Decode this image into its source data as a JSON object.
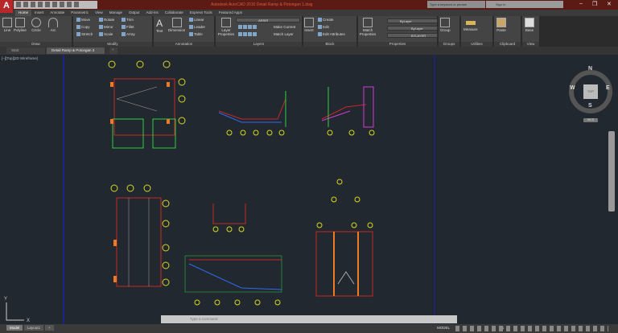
{
  "app": {
    "logo": "A",
    "title": "Autodesk AutoCAD 2016   Detail Ramp & Potongan 1.dwg",
    "search_placeholder": "Type a keyword or phrase",
    "sign_in": "Sign In"
  },
  "ribbon_tabs": [
    "Home",
    "Insert",
    "Annotate",
    "Parametric",
    "View",
    "Manage",
    "Output",
    "Add-ins",
    "Collaborate",
    "Express Tools",
    "Featured Apps"
  ],
  "active_tab": "Home",
  "panels": {
    "draw": {
      "title": "Draw",
      "line": "Line",
      "polyline": "Polyline",
      "circle": "Circle",
      "arc": "Arc"
    },
    "modify": {
      "title": "Modify",
      "move": "Move",
      "rotate": "Rotate",
      "trim": "Trim",
      "copy": "Copy",
      "mirror": "Mirror",
      "fillet": "Fillet",
      "stretch": "Stretch",
      "scale": "Scale",
      "array": "Array"
    },
    "annotation": {
      "title": "Annotation",
      "text": "Text",
      "dimension": "Dimension",
      "linear": "Linear",
      "leader": "Leader",
      "table": "Table"
    },
    "layers": {
      "title": "Layers",
      "layer_properties": "Layer Properties",
      "current_layer": "ARSIR",
      "make_current": "Make Current",
      "match_layer": "Match Layer"
    },
    "block": {
      "title": "Block",
      "insert": "Insert",
      "create": "Create",
      "edit": "Edit",
      "edit_attributes": "Edit Attributes"
    },
    "properties": {
      "title": "Properties",
      "match_properties": "Match Properties",
      "color": "ByLayer",
      "linetype": "ByLayer",
      "lineweight": "BYLAYER"
    },
    "groups": {
      "title": "Groups",
      "group": "Group"
    },
    "utilities": {
      "title": "Utilities",
      "measure": "Measure"
    },
    "clipboard": {
      "title": "Clipboard",
      "paste": "Paste"
    },
    "view": {
      "title": "View",
      "base": "Base"
    }
  },
  "file_tabs": [
    {
      "label": "Start"
    },
    {
      "label": "Detail Ramp & Potongan 3"
    }
  ],
  "viewport": {
    "label": "[–][Top][2D Wireframe]",
    "viewcube": {
      "top": "TOP",
      "n": "N",
      "s": "S",
      "e": "E",
      "w": "W",
      "wcs": "WCS"
    }
  },
  "command": {
    "placeholder": "Type a command"
  },
  "layout_tabs": [
    "Model",
    "Layout1"
  ],
  "status": {
    "model": "MODEL",
    "scale": "1:1"
  },
  "colors": {
    "titlebar": "#5b1a13",
    "canvas": "#212830",
    "accent_red": "#b8272a"
  }
}
